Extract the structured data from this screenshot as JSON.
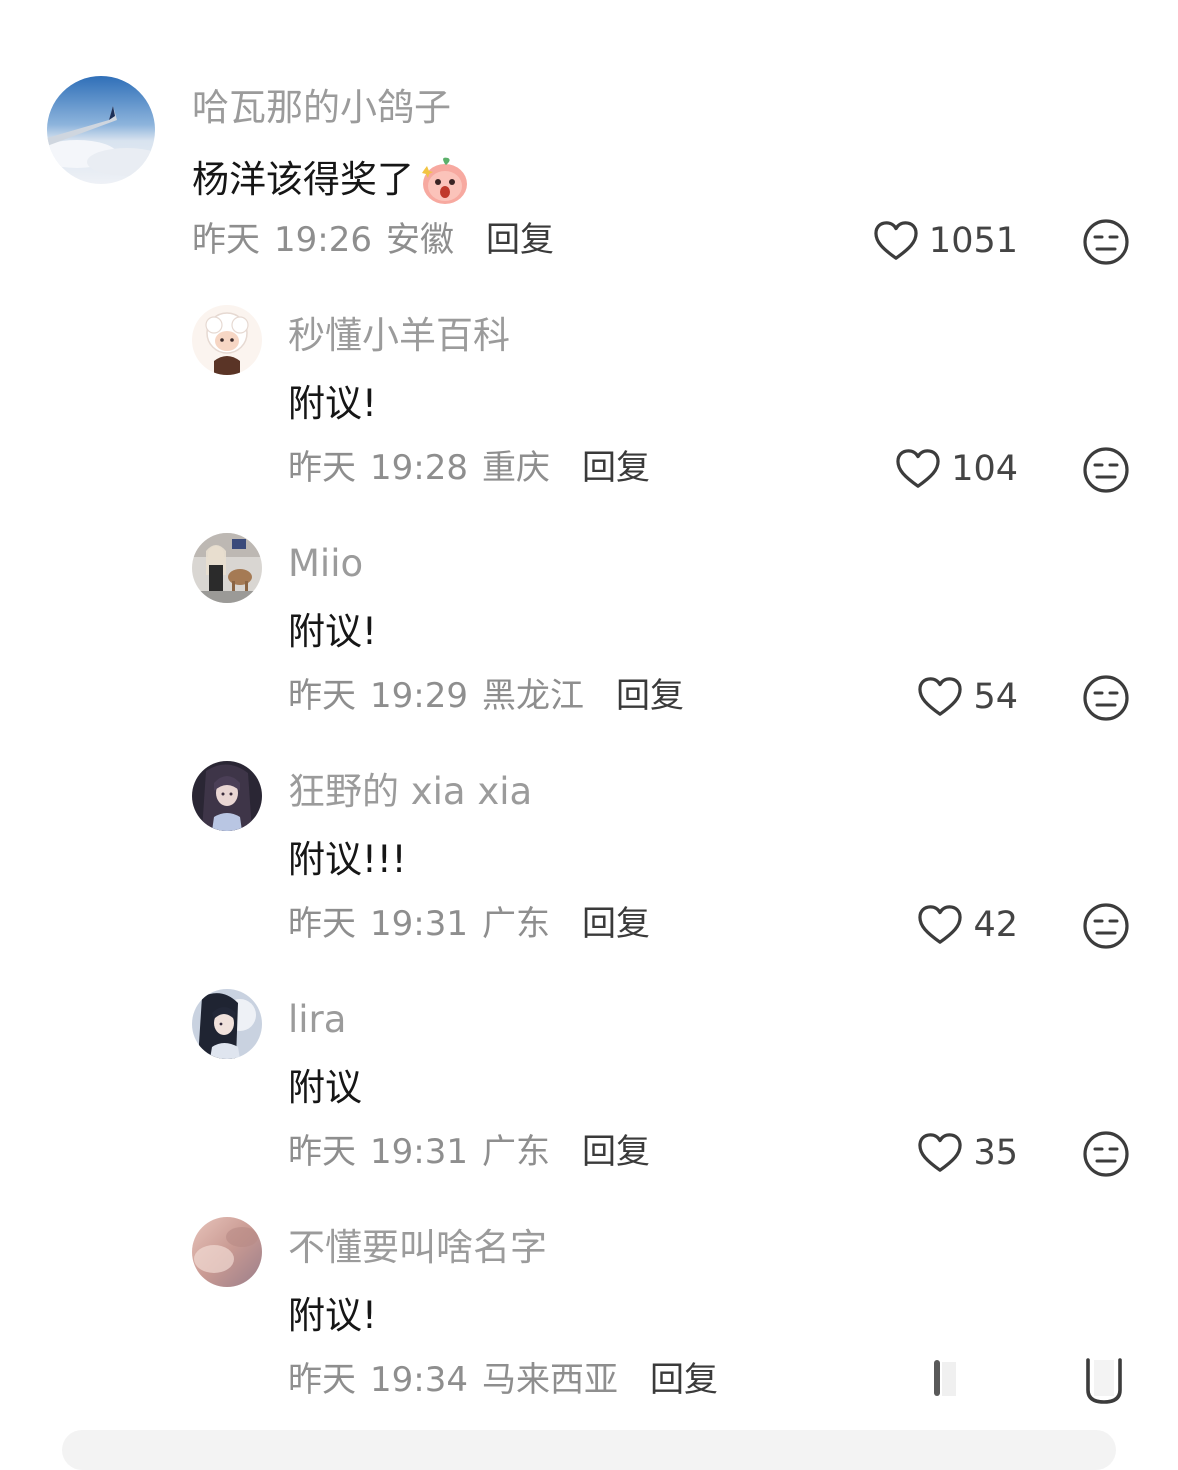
{
  "comments": [
    {
      "username": "哈瓦那的小鸽子",
      "content": "杨洋该得奖了",
      "content_emoji": "peach-surprised-emoji",
      "date": "昨天",
      "time": "19:26",
      "location": "安徽",
      "reply_label": "回复",
      "likes": "1051",
      "avatar": "airplane-wing-over-clouds"
    },
    {
      "username": "秒懂小羊百科",
      "content": "附议!",
      "date": "昨天",
      "time": "19:28",
      "location": "重庆",
      "reply_label": "回复",
      "likes": "104",
      "avatar": "cartoon-sheep"
    },
    {
      "username": "Miio",
      "content": "附议!",
      "date": "昨天",
      "time": "19:29",
      "location": "黑龙江",
      "reply_label": "回复",
      "likes": "54",
      "avatar": "girl-with-deer"
    },
    {
      "username": "狂野的 xia xia",
      "content": "附议!!!",
      "date": "昨天",
      "time": "19:31",
      "location": "广东",
      "reply_label": "回复",
      "likes": "42",
      "avatar": "anime-girl-dark"
    },
    {
      "username": "lira",
      "content": "附议",
      "date": "昨天",
      "time": "19:31",
      "location": "广东",
      "reply_label": "回复",
      "likes": "35",
      "avatar": "anime-girl-moon"
    },
    {
      "username": "不懂要叫啥名字",
      "content": "附议!",
      "date": "昨天",
      "time": "19:34",
      "location": "马来西亚",
      "reply_label": "回复",
      "avatar": "pink-sky"
    }
  ],
  "icons": {
    "like": "heart-outline-icon",
    "dislike": "neutral-face-icon"
  },
  "colors": {
    "username": "#9b9b9b",
    "content": "#161616",
    "meta": "#8e8e8e",
    "reply": "#3a3a3a",
    "icon": "#3c3c3c"
  }
}
